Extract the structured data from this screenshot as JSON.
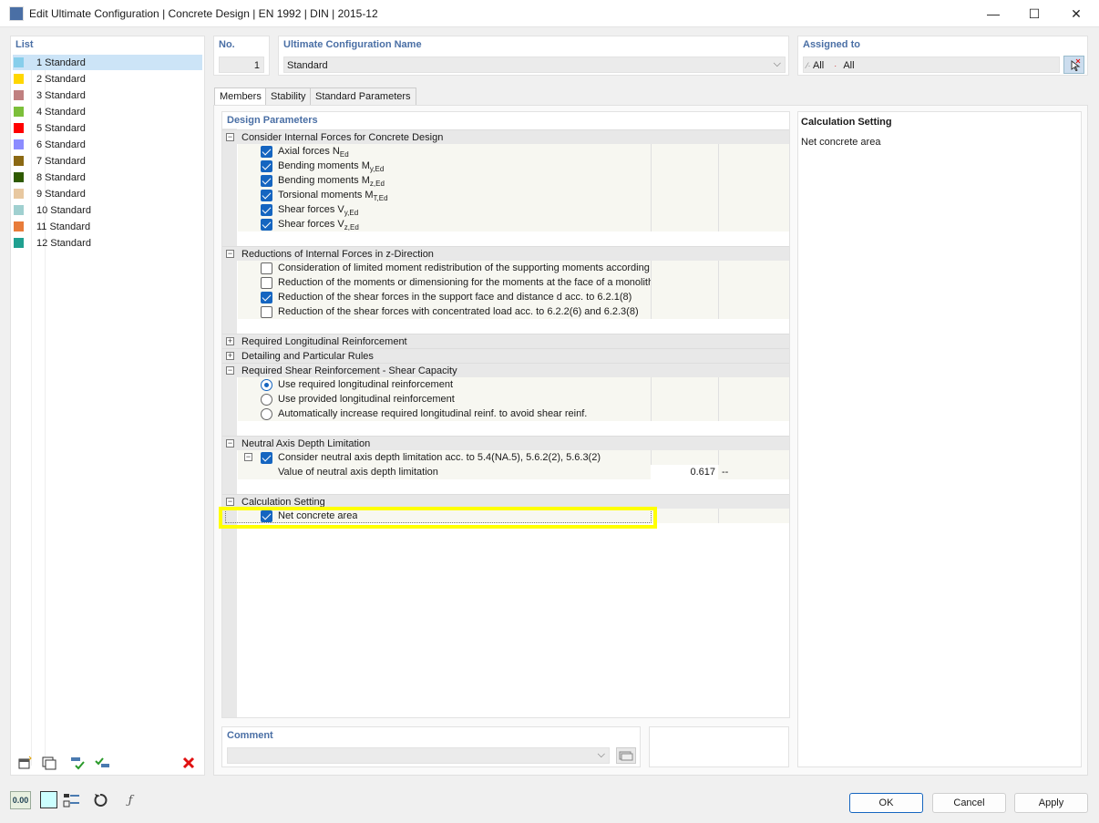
{
  "window": {
    "title": "Edit Ultimate Configuration | Concrete Design | EN 1992 | DIN | 2015-12",
    "minimize": "—",
    "maximize": "☐",
    "close": "✕"
  },
  "list": {
    "header": "List",
    "items": [
      {
        "label": "1  Standard",
        "color": "#87ceeb"
      },
      {
        "label": "2  Standard",
        "color": "#ffd700"
      },
      {
        "label": "3  Standard",
        "color": "#c08080"
      },
      {
        "label": "4  Standard",
        "color": "#7cbf3a"
      },
      {
        "label": "5  Standard",
        "color": "#ff0000"
      },
      {
        "label": "6  Standard",
        "color": "#8c8cff"
      },
      {
        "label": "7  Standard",
        "color": "#8b6914"
      },
      {
        "label": "8  Standard",
        "color": "#2f5a00"
      },
      {
        "label": "9  Standard",
        "color": "#e8c8a0"
      },
      {
        "label": "10  Standard",
        "color": "#a0d0d0"
      },
      {
        "label": "11  Standard",
        "color": "#e87c3a"
      },
      {
        "label": "12  Standard",
        "color": "#20a090"
      }
    ]
  },
  "no": {
    "header": "No.",
    "value": "1"
  },
  "name": {
    "header": "Ultimate Configuration Name",
    "value": "Standard"
  },
  "assigned": {
    "header": "Assigned to",
    "value1": "All",
    "value2": "All"
  },
  "tabs": [
    "Members",
    "Stability",
    "Standard Parameters"
  ],
  "params": {
    "header": "Design Parameters",
    "cat1": {
      "label": "Consider Internal Forces for Concrete Design",
      "items": [
        {
          "pre": "Axial forces N",
          "sub": "Ed"
        },
        {
          "pre": "Bending moments M",
          "sub": "y,Ed"
        },
        {
          "pre": "Bending moments M",
          "sub": "z,Ed"
        },
        {
          "pre": "Torsional moments M",
          "sub": "T,Ed"
        },
        {
          "pre": "Shear forces V",
          "sub": "y,Ed"
        },
        {
          "pre": "Shear forces V",
          "sub": "z,Ed"
        }
      ]
    },
    "cat2": {
      "label": "Reductions of Internal Forces in z-Direction",
      "items": [
        "Consideration of limited moment redistribution of the supporting moments according to",
        "Reduction of the moments or dimensioning for the moments at the face of a monolithic s",
        "Reduction of the shear forces in the support face and distance d acc. to 6.2.1(8)",
        "Reduction of the shear forces with concentrated load acc. to 6.2.2(6) and 6.2.3(8)"
      ]
    },
    "cat3": "Required Longitudinal Reinforcement",
    "cat4": "Detailing and Particular Rules",
    "cat5": {
      "label": "Required Shear Reinforcement - Shear Capacity",
      "items": [
        "Use required longitudinal reinforcement",
        "Use provided longitudinal reinforcement",
        "Automatically increase required longitudinal reinf. to avoid shear reinf."
      ]
    },
    "cat6": {
      "label": "Neutral Axis Depth Limitation",
      "item": "Consider neutral axis depth limitation acc. to 5.4(NA.5), 5.6.2(2), 5.6.3(2)",
      "sub_item": "Value of neutral axis depth limitation",
      "sub_value": "0.617",
      "sub_unit": "--"
    },
    "cat7": {
      "label": "Calculation Setting",
      "item": "Net concrete area"
    }
  },
  "info": {
    "title": "Calculation Setting",
    "text": "Net concrete area"
  },
  "comment": {
    "header": "Comment",
    "value": ""
  },
  "footer": {
    "ok": "OK",
    "cancel": "Cancel",
    "apply": "Apply",
    "units_icon": "0.00"
  },
  "colors": {
    "accent": "#1565c0",
    "header": "#4a6fa5",
    "highlight": "#ffff00"
  }
}
